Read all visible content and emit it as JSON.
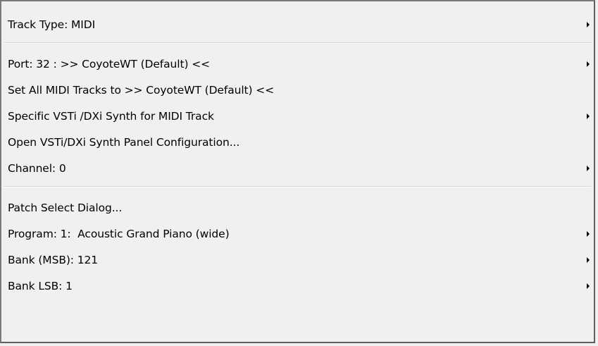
{
  "menu": {
    "items": [
      {
        "label": "Track Type: MIDI",
        "submenu": true
      },
      {
        "label": "Port: 32 : >> CoyoteWT (Default) <<",
        "submenu": true
      },
      {
        "label": "Set All MIDI Tracks to >> CoyoteWT (Default) <<",
        "submenu": false
      },
      {
        "label": "Specific VSTi /DXi Synth for MIDI Track",
        "submenu": true
      },
      {
        "label": "Open VSTi/DXi Synth Panel Configuration...",
        "submenu": false
      },
      {
        "label": "Channel: 0",
        "submenu": true
      },
      {
        "label": "Patch Select Dialog...",
        "submenu": false
      },
      {
        "label": "Program: 1:  Acoustic Grand Piano (wide)",
        "submenu": true
      },
      {
        "label": "Bank (MSB): 121",
        "submenu": true
      },
      {
        "label": "Bank LSB: 1",
        "submenu": true
      }
    ]
  }
}
